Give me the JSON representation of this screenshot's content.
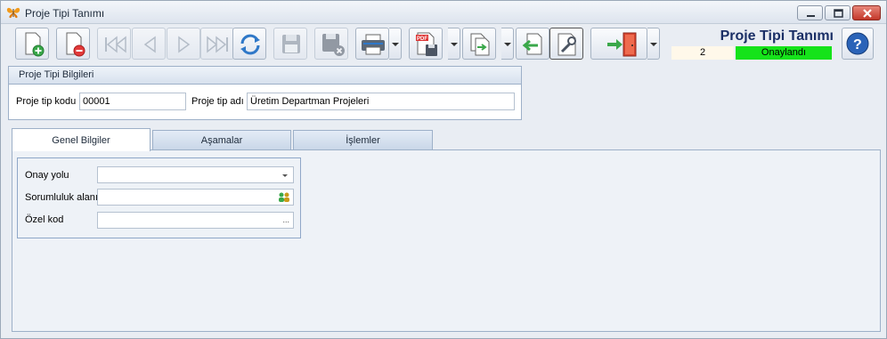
{
  "window": {
    "title": "Proje Tipi Tanımı"
  },
  "toolbar": {
    "buttons": [
      {
        "name": "new-record-icon"
      },
      {
        "name": "delete-record-icon"
      },
      {
        "name": "first-record-icon"
      },
      {
        "name": "previous-record-icon"
      },
      {
        "name": "next-record-icon"
      },
      {
        "name": "last-record-icon"
      },
      {
        "name": "refresh-icon"
      },
      {
        "name": "save-icon"
      },
      {
        "name": "save-cancel-icon"
      },
      {
        "name": "print-icon"
      },
      {
        "name": "pdf-export-icon"
      },
      {
        "name": "copy-document-icon"
      },
      {
        "name": "import-icon"
      },
      {
        "name": "settings-tool-icon"
      },
      {
        "name": "exit-door-icon"
      },
      {
        "name": "help-icon"
      }
    ]
  },
  "header": {
    "form_title": "Proje Tipi Tanımı",
    "record_no": "2",
    "status": "Onaylandı",
    "status_color": "#15e31a"
  },
  "info_group": {
    "title": "Proje Tipi Bilgileri",
    "code_label": "Proje tip kodu",
    "code_value": "00001",
    "name_label": "Proje tip adı",
    "name_value": "Üretim Departman Projeleri"
  },
  "tabs": [
    {
      "label": "Genel Bilgiler",
      "active": true
    },
    {
      "label": "Aşamalar",
      "active": false
    },
    {
      "label": "İşlemler",
      "active": false
    }
  ],
  "general": {
    "approval_label": "Onay yolu",
    "approval_value": "",
    "responsibility_label": "Sorumluluk alanı",
    "responsibility_value": "",
    "special_code_label": "Özel kod",
    "special_code_value": "",
    "ellipsis": "..."
  }
}
